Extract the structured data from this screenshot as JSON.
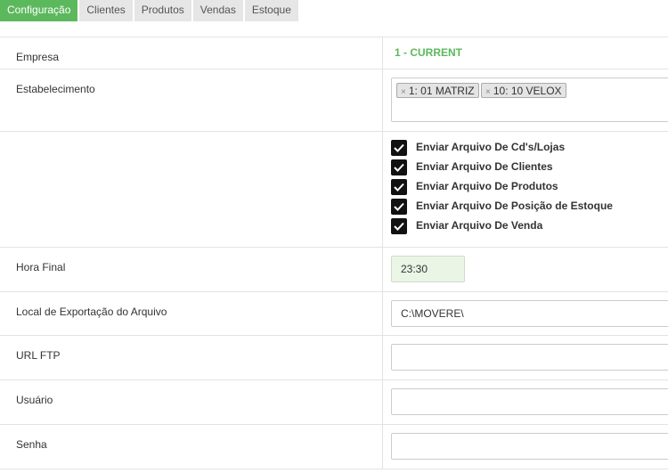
{
  "tabs": [
    {
      "label": "Configuração",
      "active": true
    },
    {
      "label": "Clientes",
      "active": false
    },
    {
      "label": "Produtos",
      "active": false
    },
    {
      "label": "Vendas",
      "active": false
    },
    {
      "label": "Estoque",
      "active": false
    }
  ],
  "form": {
    "empresa": {
      "label": "Empresa",
      "value": "1 - CURRENT"
    },
    "estabelecimento": {
      "label": "Estabelecimento",
      "chips": [
        {
          "remove": "×",
          "text": "1: 01 MATRIZ"
        },
        {
          "remove": "×",
          "text": "10: 10 VELOX"
        }
      ]
    },
    "options": [
      {
        "label": "Enviar Arquivo De Cd's/Lojas",
        "checked": true
      },
      {
        "label": "Enviar Arquivo De Clientes",
        "checked": true
      },
      {
        "label": "Enviar Arquivo De Produtos",
        "checked": true
      },
      {
        "label": "Enviar Arquivo De Posição de Estoque",
        "checked": true
      },
      {
        "label": "Enviar Arquivo De Venda",
        "checked": true
      }
    ],
    "hora_final": {
      "label": "Hora Final",
      "value": "23:30"
    },
    "local_exportacao": {
      "label": "Local de Exportação do Arquivo",
      "value": "C:\\MOVERE\\"
    },
    "url_ftp": {
      "label": "URL FTP",
      "value": ""
    },
    "usuario": {
      "label": "Usuário",
      "value": ""
    },
    "senha": {
      "label": "Senha",
      "value": ""
    }
  },
  "colors": {
    "accent": "#5cb85c",
    "checkbox": "#111111",
    "time_bg": "#eaf5e6"
  },
  "icons": {
    "check": "check-icon",
    "remove": "close-icon"
  }
}
